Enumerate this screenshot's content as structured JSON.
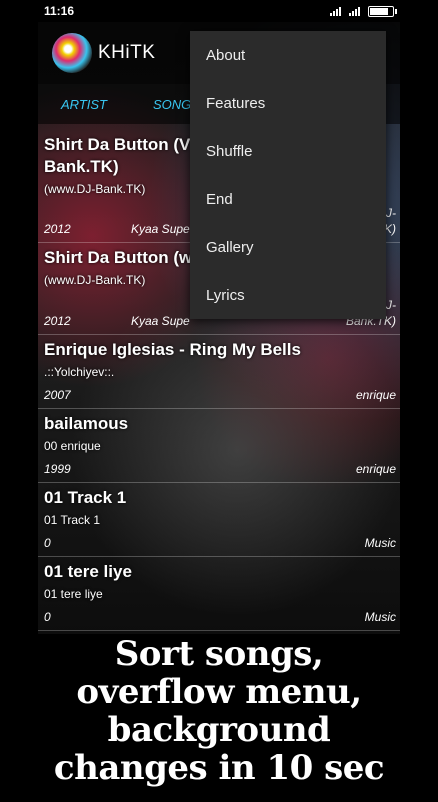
{
  "status": {
    "time": "11:16",
    "battery_level": 0.9
  },
  "app": {
    "title": "KHiTK"
  },
  "tabs": [
    {
      "label": "ARTIST"
    },
    {
      "label": "SONGS"
    }
  ],
  "songs": [
    {
      "title": "Shirt Da Button (V",
      "title2": "Bank.TK)",
      "artist": "(www.DJ-Bank.TK)",
      "year": "2012",
      "album": "Kyaa Supe",
      "genre_line1": "J-",
      "genre_line2": "K)"
    },
    {
      "title": "Shirt Da Button (w",
      "artist": "(www.DJ-Bank.TK)",
      "year": "2012",
      "album": "Kyaa Supe",
      "genre_line1": "J-",
      "genre_line2": "Bank.TK)"
    },
    {
      "title": "Enrique Iglesias - Ring My Bells",
      "artist": ".::Yolchiyev::.",
      "year": "2007",
      "genre": "enrique"
    },
    {
      "title": "bailamous",
      "artist": "00 enrique",
      "year": "1999",
      "genre": "enrique"
    },
    {
      "title": "01 Track 1",
      "artist": "01 Track 1",
      "year": "0",
      "genre": "Music"
    },
    {
      "title": "01 tere liye",
      "artist": "01 tere liye",
      "year": "0",
      "genre": "Music"
    }
  ],
  "overflow_menu": [
    {
      "label": "About"
    },
    {
      "label": "Features"
    },
    {
      "label": "Shuffle"
    },
    {
      "label": "End"
    },
    {
      "label": "Gallery"
    },
    {
      "label": "Lyrics"
    }
  ],
  "caption": {
    "line1": "Sort  songs,",
    "line2": "overflow menu,",
    "line3": "background",
    "line4": "changes in 10 sec"
  }
}
